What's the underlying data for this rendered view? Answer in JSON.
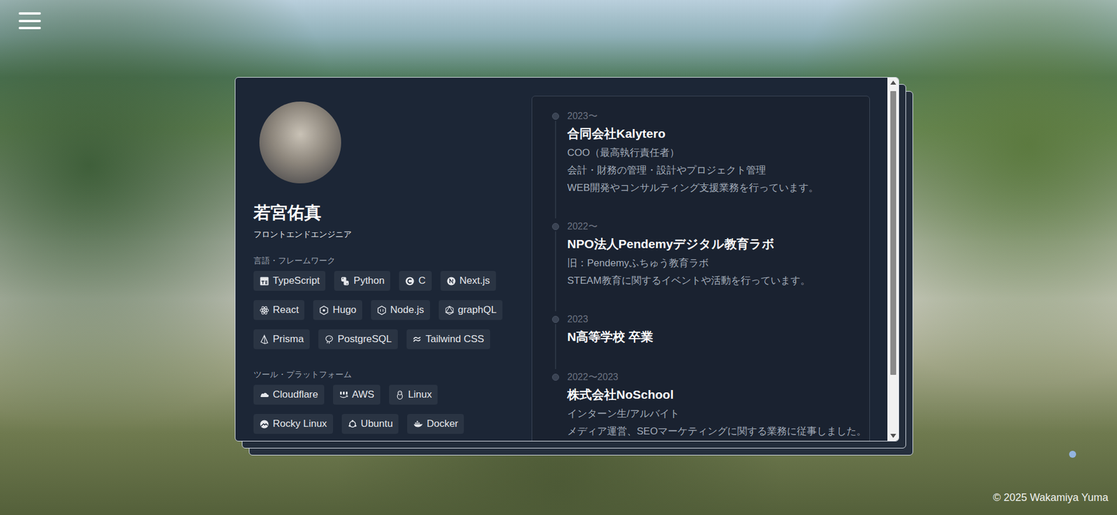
{
  "profile": {
    "name": "若宮佑真",
    "role": "フロントエンドエンジニア"
  },
  "skill_groups": [
    {
      "title": "言語・フレームワーク",
      "items": [
        "TypeScript",
        "Python",
        "C",
        "Next.js",
        "React",
        "Hugo",
        "Node.js",
        "graphQL",
        "Prisma",
        "PostgreSQL",
        "Tailwind CSS"
      ]
    },
    {
      "title": "ツール・プラットフォーム",
      "items": [
        "Cloudflare",
        "AWS",
        "Linux",
        "Rocky Linux",
        "Ubuntu",
        "Docker"
      ]
    }
  ],
  "timeline": [
    {
      "period": "2023〜",
      "title": "合同会社Kalytero",
      "lines": [
        "COO（最高執行責任者）",
        "会計・財務の管理・設計やプロジェクト管理",
        "WEB開発やコンサルティング支援業務を行っています。"
      ]
    },
    {
      "period": "2022〜",
      "title": "NPO法人Pendemyデジタル教育ラボ",
      "lines": [
        "旧：Pendemyふちゅう教育ラボ",
        "STEAM教育に関するイベントや活動を行っています。"
      ]
    },
    {
      "period": "2023",
      "title": "N高等学校 卒業",
      "lines": []
    },
    {
      "period": "2022〜2023",
      "title": "株式会社NoSchool",
      "lines": [
        "インターン生/アルバイト",
        "メディア運営、SEOマーケティングに関する業務に従事しました。"
      ]
    }
  ],
  "pagination": [
    {
      "selected": true
    }
  ],
  "footer": "© 2025 Wakamiya Yuma"
}
